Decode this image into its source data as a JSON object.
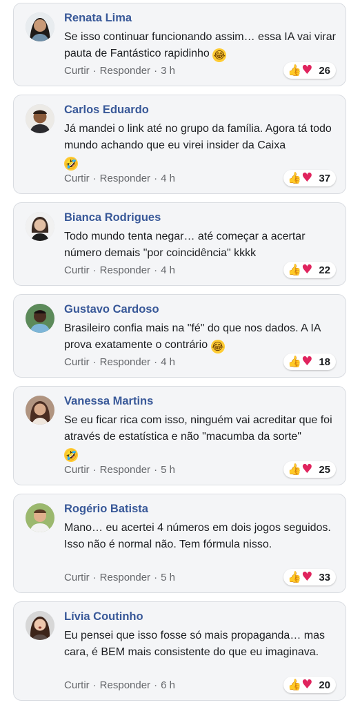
{
  "actions": {
    "like_label": "Curtir",
    "reply_label": "Responder",
    "separator": "·"
  },
  "icons": {
    "like": "thumbs-up-icon",
    "love": "heart-icon",
    "laugh": "laughing-emoji-icon",
    "rofl": "rolling-laughing-emoji-icon"
  },
  "colors": {
    "name": "#385898",
    "card_bg": "#f4f5f7",
    "meta": "#65676b",
    "heart": "#e0245e",
    "like": "#f0b43a"
  },
  "comments": [
    {
      "name": "Renata Lima",
      "text": "Se isso continuar funcionando assim… essa IA vai virar pauta de Fantástico rapidinho",
      "emoji": "😂",
      "time": "3 h",
      "reactions": "26"
    },
    {
      "name": "Carlos Eduardo",
      "text": "Já mandei o link até no grupo da família. Agora tá todo mundo achando que eu virei insider da Caixa",
      "emoji": "🤣",
      "time": "4 h",
      "reactions": "37"
    },
    {
      "name": "Bianca Rodrigues",
      "text": "Todo mundo tenta negar… até começar a acertar número demais \"por coincidência\" kkkk",
      "emoji": "",
      "time": "4 h",
      "reactions": "22"
    },
    {
      "name": "Gustavo Cardoso",
      "text": "Brasileiro confia mais na \"fé\" do que nos dados. A IA prova exatamente o contrário",
      "emoji": "😂",
      "time": "4 h",
      "reactions": "18"
    },
    {
      "name": "Vanessa Martins",
      "text": "Se eu ficar rica com isso, ninguém vai acreditar que foi através de estatística e não \"macumba da sorte\"",
      "emoji": "🤣",
      "time": "5 h",
      "reactions": "25"
    },
    {
      "name": "Rogério Batista",
      "text": "Mano… eu acertei 4 números em dois jogos seguidos. Isso não é normal não. Tem fórmula nisso.",
      "emoji": "",
      "time": "5 h",
      "reactions": "33"
    },
    {
      "name": "Lívia Coutinho",
      "text": "Eu pensei que isso fosse só mais propaganda… mas cara, é BEM mais consistente do que eu imaginava.",
      "emoji": "",
      "time": "6 h",
      "reactions": "20"
    }
  ]
}
